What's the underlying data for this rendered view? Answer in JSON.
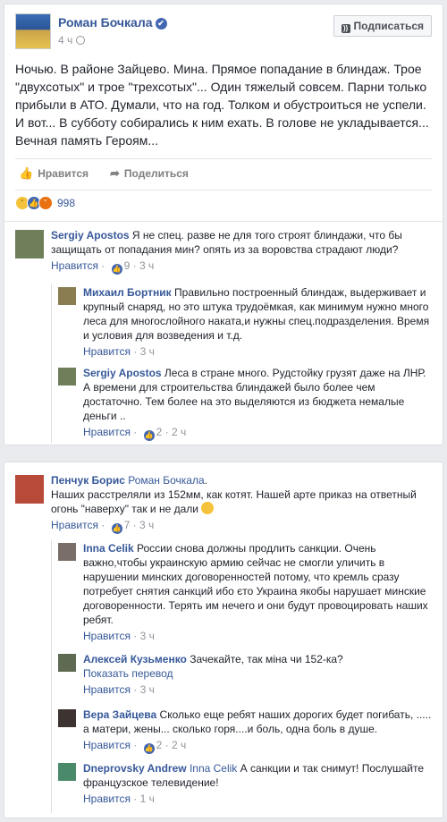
{
  "post": {
    "author": "Роман Бочкала",
    "time": "4 ч",
    "subscribe_label": "Подписаться",
    "text": "Ночью. В районе Зайцево. Мина. Прямое попадание в блиндаж. Трое \"двухсотых\" и трое \"трехсотых\"... Один тяжелый совсем. Парни только прибыли в АТО. Думали, что на год. Толком и обустроиться не успели. И вот... В субботу собирались к ним ехать. В голове не укладывается... Вечная память Героям...",
    "like_label": "Нравится",
    "share_label": "Поделиться",
    "reaction_count": "998"
  },
  "thread1": {
    "comment": {
      "author": "Sergiy Apostos",
      "text": "Я не спец. разве не для того строят блиндажи, что бы защищать от попадания мин? опять из за воровства страдают люди?",
      "like_label": "Нравится",
      "likes": "9",
      "time": "3 ч"
    },
    "replies": [
      {
        "author": "Михаил Бортник",
        "text": "Правильно построенный блиндаж, выдерживает и крупный снаряд, но это штука трудоёмкая, как минимум нужно много леса для многослойного наката,и нужны спец.подразделения. Время и условия для возведения и т.д.",
        "like_label": "Нравится",
        "time": "3 ч"
      },
      {
        "author": "Sergiy Apostos",
        "text": "Леса в стране много. Рудстойку грузят даже на ЛНР. А времени для строительства блиндажей было более чем достаточно. Тем более на это выделяются из бюджета немалые деньги ..",
        "like_label": "Нравится",
        "likes": "2",
        "time": "2 ч"
      }
    ]
  },
  "thread2": {
    "comment": {
      "author": "Пенчук Борис",
      "mention": "Роман Бочкала",
      "text": "Наших расстреляли из 152мм, как котят. Нашей арте приказ на ответный огонь \"наверху\" так и не дали",
      "like_label": "Нравится",
      "likes": "7",
      "time": "3 ч"
    },
    "replies": [
      {
        "author": "Іnna Celik",
        "text": "России снова должны продлить санкции. Очень важно,чтобы украинскую армию сейчас не смогли уличить в нарушении минских договоренностей потому, что кремль сразу потребует снятия санкций ибо єто Украина якобы нарушает минские договоренности. Терять им нечего и они будут провоцировать наших ребят.",
        "like_label": "Нравится",
        "time": "3 ч"
      },
      {
        "author": "Алексей Кузьменко",
        "text": "Зачекайте, так міна чи 152-ка?",
        "translate_label": "Показать перевод",
        "like_label": "Нравится",
        "time": "3 ч"
      },
      {
        "author": "Вера Зайцева",
        "text": "Сколько еще ребят наших дорогих будет погибать, ..... а матери, жены... сколько горя....и боль, одна боль в душе.",
        "like_label": "Нравится",
        "likes": "2",
        "time": "2 ч"
      },
      {
        "author": "Dneprovsky Andrew",
        "mention": "Іnna Celik",
        "text": "А санкции и так снимут! Послушайте французское телевидение!",
        "like_label": "Нравится",
        "time": "1 ч"
      }
    ]
  }
}
